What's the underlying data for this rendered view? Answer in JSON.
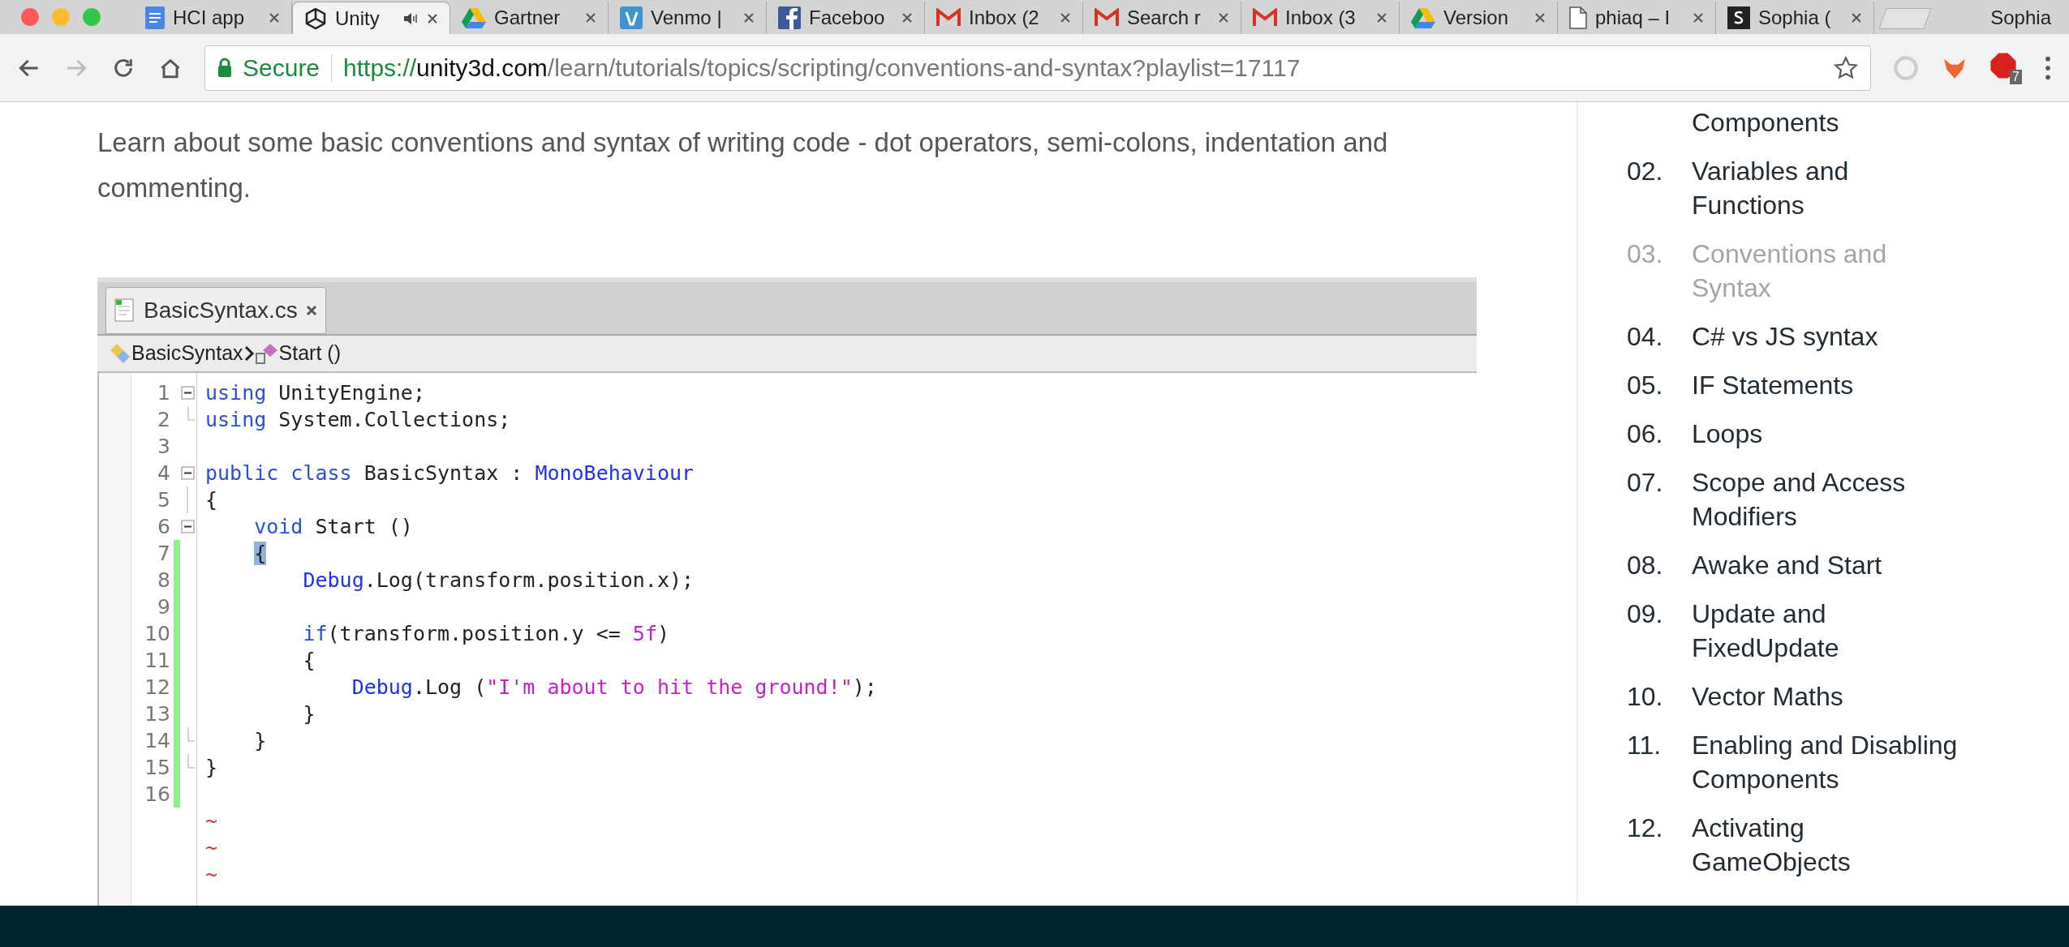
{
  "browser": {
    "tabs": [
      {
        "title": "HCI app",
        "kind": "doc",
        "selected": false,
        "audio": false
      },
      {
        "title": "Unity",
        "kind": "unity",
        "selected": true,
        "audio": true
      },
      {
        "title": "Gartner",
        "kind": "drive",
        "selected": false,
        "audio": false
      },
      {
        "title": "Venmo |",
        "kind": "venmo",
        "selected": false,
        "audio": false
      },
      {
        "title": "Faceboo",
        "kind": "facebook",
        "selected": false,
        "audio": false
      },
      {
        "title": "Inbox (2",
        "kind": "mail",
        "selected": false,
        "audio": false
      },
      {
        "title": "Search r",
        "kind": "mail",
        "selected": false,
        "audio": false
      },
      {
        "title": "Inbox (3",
        "kind": "mail",
        "selected": false,
        "audio": false
      },
      {
        "title": "Version",
        "kind": "drive",
        "selected": false,
        "audio": false
      },
      {
        "title": "phiaq – I",
        "kind": "file",
        "selected": false,
        "audio": false
      },
      {
        "title": "Sophia (",
        "kind": "square",
        "selected": false,
        "audio": false
      }
    ],
    "profile": "Sophia",
    "address": {
      "secure_label": "Secure",
      "scheme": "https://",
      "host": "unity3d.com",
      "path": "/learn/tutorials/topics/scripting/conventions-and-syntax?playlist=17117"
    },
    "extension_badge": "7"
  },
  "intro": "Learn about some basic conventions and syntax of writing code - dot operators, semi-colons, indentation and commenting.",
  "editor": {
    "file_tab": "BasicSyntax.cs",
    "breadcrumb": [
      "BasicSyntax",
      "Start ()"
    ],
    "lines": [
      {
        "number": "1",
        "fold": {
          "kind": "open"
        },
        "changed": false,
        "tokens": [
          {
            "text": "using",
            "kind": "keyword"
          },
          {
            "text": " UnityEngine;",
            "kind": "plain"
          }
        ]
      },
      {
        "number": "2",
        "fold": {
          "kind": "end"
        },
        "changed": false,
        "tokens": [
          {
            "text": "using",
            "kind": "keyword"
          },
          {
            "text": " System.Collections;",
            "kind": "plain"
          }
        ]
      },
      {
        "number": "3",
        "changed": false
      },
      {
        "number": "4",
        "fold": {
          "kind": "open"
        },
        "changed": false,
        "tokens": [
          {
            "text": "public class",
            "kind": "keyword"
          },
          {
            "text": " BasicSyntax : ",
            "kind": "plain"
          },
          {
            "text": "MonoBehaviour",
            "kind": "type"
          }
        ]
      },
      {
        "number": "5",
        "fold": {
          "kind": "line"
        },
        "changed": false,
        "tokens": [
          {
            "text": "{",
            "kind": "plain"
          }
        ]
      },
      {
        "number": "6",
        "fold": {
          "kind": "open"
        },
        "changed": false,
        "tokens": [
          {
            "text": "    void",
            "kind": "keyword"
          },
          {
            "text": " Start ()",
            "kind": "plain"
          }
        ]
      },
      {
        "number": "7",
        "changed": true,
        "tokens": [
          {
            "text": "    {",
            "kind": "selection"
          }
        ]
      },
      {
        "number": "8",
        "changed": true,
        "tokens": [
          {
            "text": "        Debug",
            "kind": "type"
          },
          {
            "text": ".Log(transform.position.x);",
            "kind": "plain"
          }
        ]
      },
      {
        "number": "9",
        "changed": true
      },
      {
        "number": "10",
        "changed": true,
        "tokens": [
          {
            "text": "        if",
            "kind": "keyword"
          },
          {
            "text": "(transform.position.y <= ",
            "kind": "plain"
          },
          {
            "text": "5f",
            "kind": "number"
          },
          {
            "text": ")",
            "kind": "plain"
          }
        ]
      },
      {
        "number": "11",
        "changed": true,
        "tokens": [
          {
            "text": "        {",
            "kind": "plain"
          }
        ]
      },
      {
        "number": "12",
        "changed": true,
        "tokens": [
          {
            "text": "            Debug",
            "kind": "type"
          },
          {
            "text": ".Log (",
            "kind": "plain"
          },
          {
            "text": "\"I'm about to hit the ground!\"",
            "kind": "string"
          },
          {
            "text": ");",
            "kind": "plain"
          }
        ]
      },
      {
        "number": "13",
        "changed": true,
        "tokens": [
          {
            "text": "        }",
            "kind": "plain"
          }
        ]
      },
      {
        "number": "14",
        "fold": {
          "kind": "end"
        },
        "changed": true,
        "tokens": [
          {
            "text": "    }",
            "kind": "plain"
          }
        ]
      },
      {
        "number": "15",
        "fold": {
          "kind": "end"
        },
        "changed": true,
        "tokens": [
          {
            "text": "}",
            "kind": "plain"
          }
        ]
      },
      {
        "number": "16",
        "changed": true
      }
    ],
    "end_markers": [
      "~",
      "~",
      "~"
    ]
  },
  "playlist": [
    {
      "label": "Components",
      "selected": false
    },
    {
      "number": "02.",
      "label": "Variables and Functions",
      "selected": false
    },
    {
      "number": "03.",
      "label": "Conventions and Syntax",
      "selected": true
    },
    {
      "number": "04.",
      "label": "C# vs JS syntax",
      "selected": false
    },
    {
      "number": "05.",
      "label": "IF Statements",
      "selected": false
    },
    {
      "number": "06.",
      "label": "Loops",
      "selected": false
    },
    {
      "number": "07.",
      "label": "Scope and Access Modifiers",
      "selected": false
    },
    {
      "number": "08.",
      "label": "Awake and Start",
      "selected": false
    },
    {
      "number": "09.",
      "label": "Update and FixedUpdate",
      "selected": false
    },
    {
      "number": "10.",
      "label": "Vector Maths",
      "selected": false
    },
    {
      "number": "11.",
      "label": "Enabling and Disabling Components",
      "selected": false
    },
    {
      "number": "12.",
      "label": "Activating GameObjects",
      "selected": false
    }
  ]
}
